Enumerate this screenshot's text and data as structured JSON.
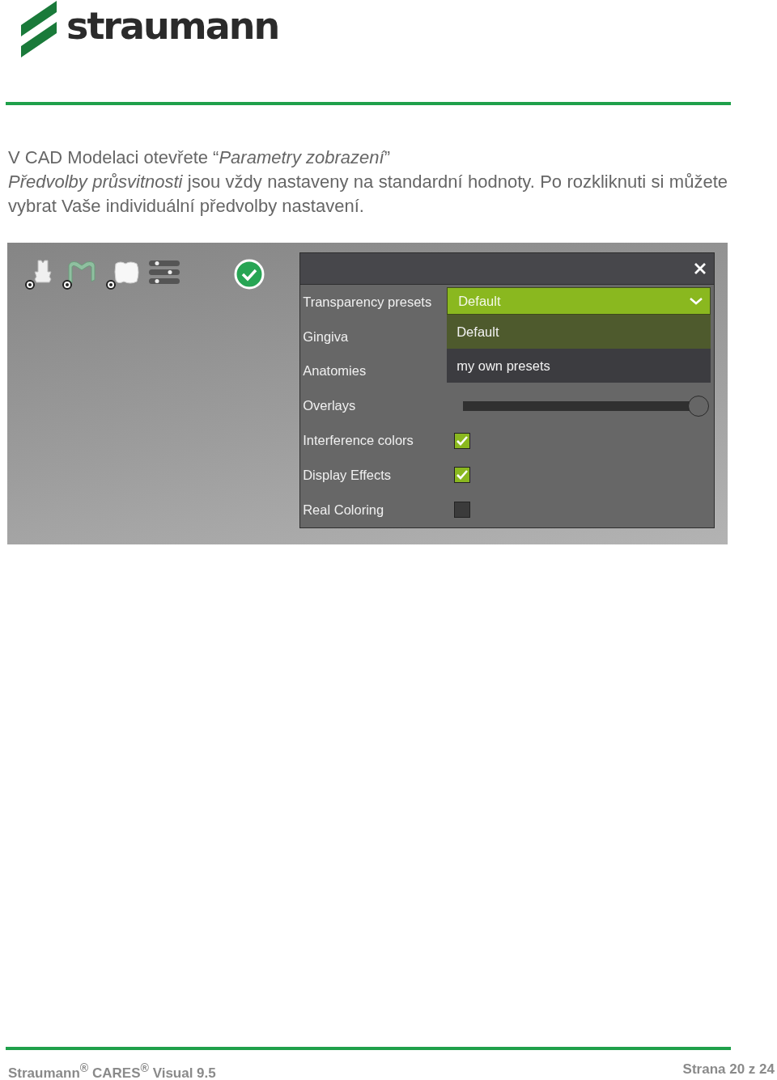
{
  "logo": {
    "name": "straumann"
  },
  "intro": [
    "V CAD Modelaci otevřete “*Parametry zobrazení*”",
    "*Předvolby průsvitnosti* jsou vždy nastaveny na standardní hodnoty. Po rozkliknuti si můžete vybrat Vaše individuální předvolby nastavení."
  ],
  "screenshot": {
    "panel": {
      "rows": [
        {
          "kind": "dropdown",
          "label": "Transparency presets",
          "value": "Default",
          "expanded": true,
          "options": [
            {
              "label": "Default",
              "selected": true
            },
            {
              "label": "my own presets",
              "selected": false
            }
          ]
        },
        {
          "kind": "blank",
          "label": "Gingiva"
        },
        {
          "kind": "blank",
          "label": "Anatomies"
        },
        {
          "kind": "slider",
          "label": "Overlays",
          "level": 1
        },
        {
          "kind": "checkbox",
          "label": "Interference colors",
          "checked": true
        },
        {
          "kind": "checkbox",
          "label": "Display Effects",
          "checked": true
        },
        {
          "kind": "checkbox",
          "label": "Real Coloring",
          "checked": false
        }
      ]
    }
  },
  "footer": {
    "product": "Straumann$^{®}$ CARES$^{®}$ Visual 9.5",
    "page": "Strana 20 z 24"
  }
}
